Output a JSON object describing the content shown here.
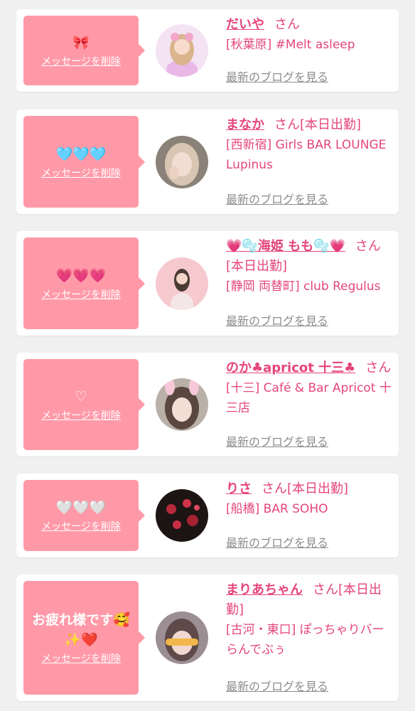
{
  "delete_label": "メッセージを削除",
  "san_label": "さん",
  "blog_label": "最新のブログを見る",
  "cards": [
    {
      "message": "🎀",
      "name": "だいや",
      "workday": "",
      "shop": "[秋葉原] #Melt asleep",
      "avatar_icon": "girl-pink-outfit-photo"
    },
    {
      "message": "🩵🩵🩵",
      "name": "まなか",
      "workday": "[本日出勤]",
      "shop": "[西新宿] Girls BAR LOUNGE Lupinus",
      "avatar_icon": "girl-selfie-photo"
    },
    {
      "message": "💗💗💗",
      "name": "💗🫧海姫 もも🫧💗",
      "workday": "[本日出勤]",
      "shop": "[静岡 両替町] club Regulus",
      "avatar_icon": "girl-pink-background-photo"
    },
    {
      "message": "♡",
      "name": "のか♣apricot 十三♣",
      "workday": "",
      "shop": "[十三] Café & Bar Apricot 十三店",
      "avatar_icon": "girl-bunny-ears-photo"
    },
    {
      "message": "🤍🤍🤍",
      "name": "りさ",
      "workday": "[本日出勤]",
      "shop": "[船橋] BAR SOHO",
      "avatar_icon": "dark-flowers-photo"
    },
    {
      "message": "お疲れ様です🥰✨❤️",
      "name": "まりあちゃん",
      "workday": "[本日出勤]",
      "shop": "[古河・東口] ぽっちゃりバー らんでぶぅ",
      "avatar_icon": "girl-happy-filter-photo"
    }
  ],
  "colors": {
    "accent": "#e5457a",
    "message_bg": "#ff99a8",
    "page_bg": "#f0f0f0"
  }
}
